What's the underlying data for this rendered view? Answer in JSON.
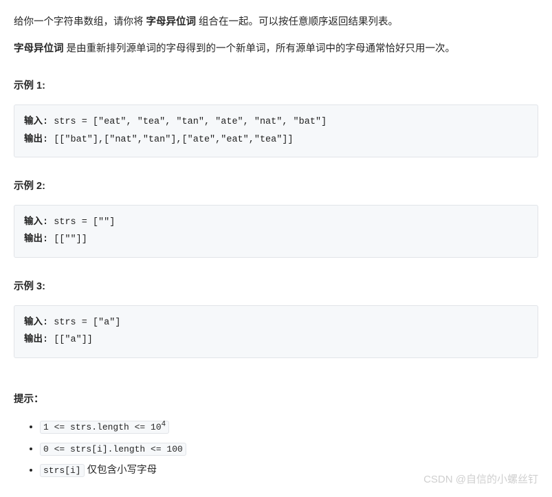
{
  "intro": {
    "part1": "给你一个字符串数组，请你将 ",
    "bold1": "字母异位词",
    "part2": " 组合在一起。可以按任意顺序返回结果列表。",
    "bold2": "字母异位词",
    "part3": " 是由重新排列源单词的字母得到的一个新单词，所有源单词中的字母通常恰好只用一次。"
  },
  "examples": [
    {
      "title": "示例 1:",
      "input_label": "输入: ",
      "input_value": "strs = [\"eat\", \"tea\", \"tan\", \"ate\", \"nat\", \"bat\"]",
      "output_label": "输出: ",
      "output_value": "[[\"bat\"],[\"nat\",\"tan\"],[\"ate\",\"eat\",\"tea\"]]"
    },
    {
      "title": "示例 2:",
      "input_label": "输入: ",
      "input_value": "strs = [\"\"]",
      "output_label": "输出: ",
      "output_value": "[[\"\"]]"
    },
    {
      "title": "示例 3:",
      "input_label": "输入: ",
      "input_value": "strs = [\"a\"]",
      "output_label": "输出: ",
      "output_value": "[[\"a\"]]"
    }
  ],
  "hints": {
    "title": "提示：",
    "items": [
      {
        "code_pre": "1 <= strs.length <= 10",
        "sup": "4",
        "after": ""
      },
      {
        "code_pre": "0 <= strs[i].length <= 100",
        "sup": "",
        "after": ""
      },
      {
        "code_pre": "strs[i]",
        "sup": "",
        "after": " 仅包含小写字母"
      }
    ]
  },
  "watermark": "CSDN @自信的小螺丝钉"
}
